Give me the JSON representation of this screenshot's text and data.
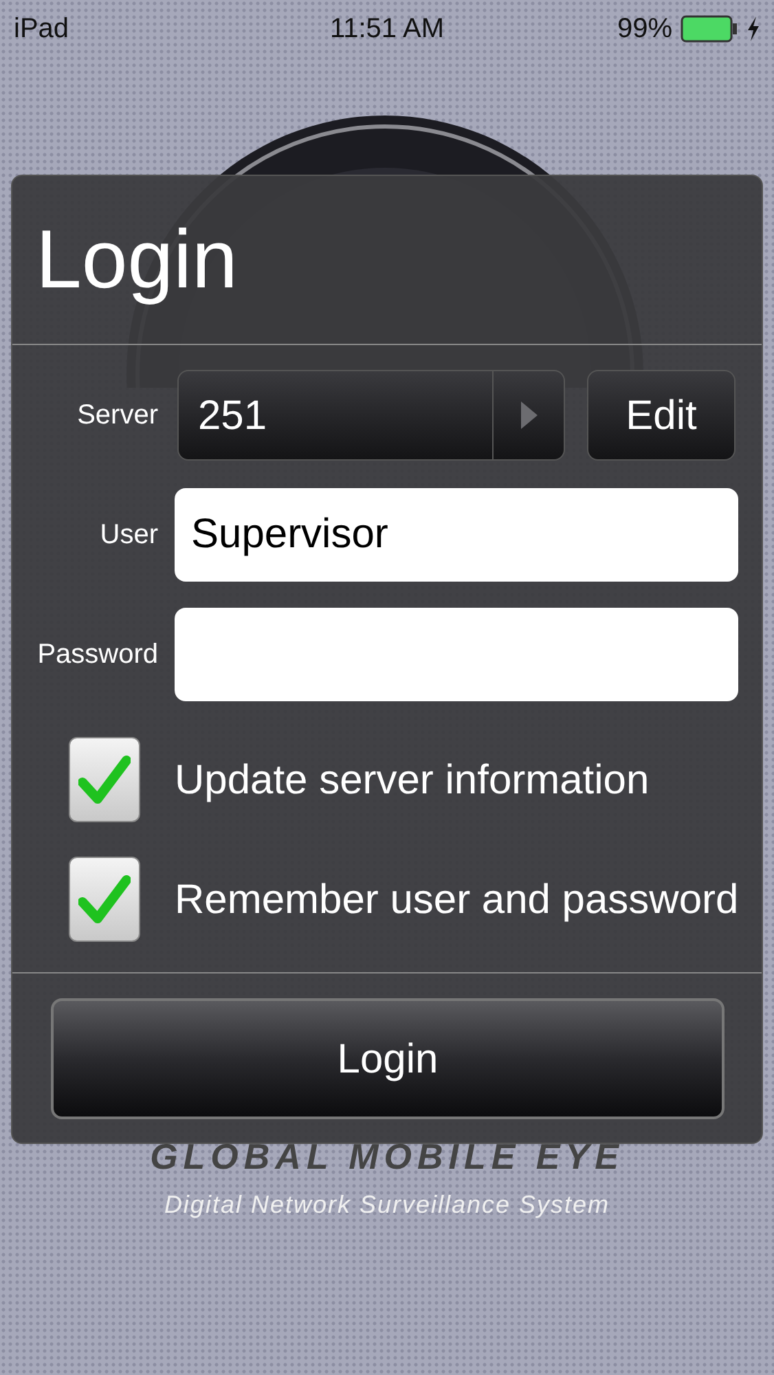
{
  "status_bar": {
    "device": "iPad",
    "time": "11:51 AM",
    "battery": "99%"
  },
  "login_panel": {
    "title": "Login",
    "server": {
      "label": "Server",
      "value": "251",
      "button": "Edit"
    },
    "user": {
      "label": "User",
      "value": "Supervisor"
    },
    "password": {
      "label": "Password"
    },
    "options": [
      {
        "label": "Update server information",
        "checked": true
      },
      {
        "label": "Remember user and password",
        "checked": true
      }
    ],
    "submit": "Login"
  },
  "branding": {
    "logo": "GLOBAL MOBILE EYE",
    "tagline": "Digital Network Surveillance System"
  }
}
